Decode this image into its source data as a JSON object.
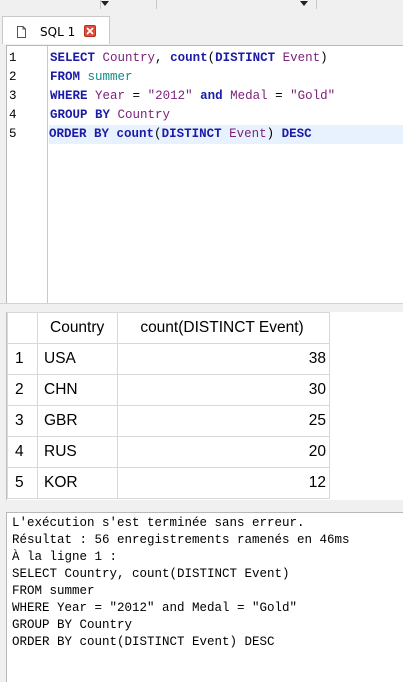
{
  "tab": {
    "label": "SQL 1",
    "close_icon": "close-icon",
    "doc_icon": "document-icon"
  },
  "editor": {
    "line_numbers": [
      "1",
      "2",
      "3",
      "4",
      "5"
    ],
    "lines": [
      [
        {
          "t": "SELECT",
          "c": "kw"
        },
        {
          "t": " ",
          "c": "op"
        },
        {
          "t": "Country",
          "c": "id"
        },
        {
          "t": ", ",
          "c": "op"
        },
        {
          "t": "count",
          "c": "kw"
        },
        {
          "t": "(",
          "c": "op"
        },
        {
          "t": "DISTINCT",
          "c": "kw"
        },
        {
          "t": " ",
          "c": "op"
        },
        {
          "t": "Event",
          "c": "id"
        },
        {
          "t": ")",
          "c": "op"
        }
      ],
      [
        {
          "t": "FROM",
          "c": "kw"
        },
        {
          "t": " ",
          "c": "op"
        },
        {
          "t": "summer",
          "c": "tbl"
        }
      ],
      [
        {
          "t": "WHERE",
          "c": "kw"
        },
        {
          "t": " ",
          "c": "op"
        },
        {
          "t": "Year",
          "c": "id"
        },
        {
          "t": " = ",
          "c": "op"
        },
        {
          "t": "\"2012\"",
          "c": "str"
        },
        {
          "t": " ",
          "c": "op"
        },
        {
          "t": "and",
          "c": "kw"
        },
        {
          "t": " ",
          "c": "op"
        },
        {
          "t": "Medal",
          "c": "id"
        },
        {
          "t": " = ",
          "c": "op"
        },
        {
          "t": "\"Gold\"",
          "c": "str"
        }
      ],
      [
        {
          "t": "GROUP BY",
          "c": "kw"
        },
        {
          "t": " ",
          "c": "op"
        },
        {
          "t": "Country",
          "c": "id"
        }
      ],
      [
        {
          "t": "ORDER BY",
          "c": "kw"
        },
        {
          "t": " ",
          "c": "op"
        },
        {
          "t": "count",
          "c": "kw"
        },
        {
          "t": "(",
          "c": "op"
        },
        {
          "t": "DISTINCT",
          "c": "kw"
        },
        {
          "t": " ",
          "c": "op"
        },
        {
          "t": "Event",
          "c": "id"
        },
        {
          "t": ") ",
          "c": "op"
        },
        {
          "t": "DESC",
          "c": "kw"
        }
      ]
    ],
    "current_line": 5
  },
  "results": {
    "columns": [
      "Country",
      "count(DISTINCT Event)"
    ],
    "rows": [
      {
        "n": "1",
        "country": "USA",
        "count": "38"
      },
      {
        "n": "2",
        "country": "CHN",
        "count": "30"
      },
      {
        "n": "3",
        "country": "GBR",
        "count": "25"
      },
      {
        "n": "4",
        "country": "RUS",
        "count": "20"
      },
      {
        "n": "5",
        "country": "KOR",
        "count": "12"
      }
    ]
  },
  "log": {
    "lines": [
      "L'exécution s'est terminée sans erreur.",
      "Résultat : 56 enregistrements ramenés en 46ms",
      "À la ligne 1 :",
      "SELECT Country, count(DISTINCT Event)",
      "FROM summer",
      "WHERE Year = \"2012\" and Medal = \"Gold\"",
      "GROUP BY Country",
      "ORDER BY count(DISTINCT Event) DESC"
    ]
  },
  "colors": {
    "keyword": "#1b1ba8",
    "identifier": "#7a1f7a",
    "table": "#138a8a",
    "current_line": "#e8f2fe",
    "close_button": "#e24a3b"
  }
}
